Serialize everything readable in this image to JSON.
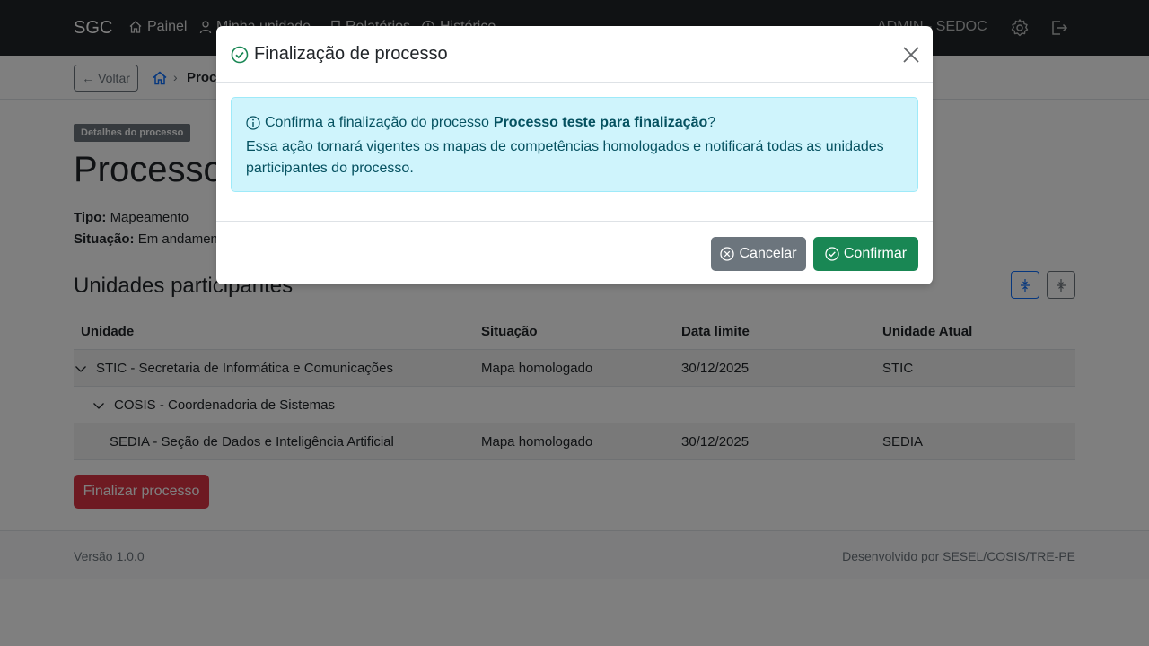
{
  "navbar": {
    "brand": "SGC",
    "links": [
      {
        "label": "Painel",
        "icon": "home-icon"
      },
      {
        "label": "Minha unidade",
        "icon": "person-icon"
      },
      {
        "label": "Relatórios",
        "icon": "bookmark-icon"
      },
      {
        "label": "Histórico",
        "icon": "clock-icon"
      }
    ],
    "user": "ADMIN - SEDOC"
  },
  "breadcrumb": {
    "back_label": "Voltar",
    "separator": "›",
    "current": "Processo"
  },
  "process": {
    "badge": "Detalhes do processo",
    "title": "Processo teste para finalização",
    "tipo_label": "Tipo:",
    "tipo_value": "Mapeamento",
    "situacao_label": "Situação:",
    "situacao_value": "Em andamento"
  },
  "units": {
    "title": "Unidades participantes",
    "headers": [
      "Unidade",
      "Situação",
      "Data limite",
      "Unidade Atual"
    ],
    "rows": [
      {
        "unidade": "STIC - Secretaria de Informática e Comunicações",
        "situacao": "Mapa homologado",
        "data": "30/12/2025",
        "atual": "STIC"
      },
      {
        "unidade": "COSIS - Coordenadoria de Sistemas",
        "situacao": "",
        "data": "",
        "atual": ""
      },
      {
        "unidade": "SEDIA - Seção de Dados e Inteligência Artificial",
        "situacao": "Mapa homologado",
        "data": "30/12/2025",
        "atual": "SEDIA"
      }
    ]
  },
  "finalize_button": "Finalizar processo",
  "footer": {
    "version": "Versão 1.0.0",
    "credit": "Desenvolvido por SESEL/COSIS/TRE-PE"
  },
  "modal": {
    "title": "Finalização de processo",
    "confirm_prefix": "Confirma a finalização do processo",
    "process_name": "Processo teste para finalização",
    "confirm_suffix": "?",
    "description": "Essa ação tornará vigentes os mapas de competências homologados e notificará todas as unidades participantes do processo.",
    "cancel_label": "Cancelar",
    "confirm_label": "Confirmar"
  },
  "colors": {
    "navbar": "#212529",
    "primary": "#0d6efd",
    "danger": "#dc3545",
    "success": "#198754",
    "secondary": "#6c757d",
    "info_bg": "#cff4fc"
  }
}
